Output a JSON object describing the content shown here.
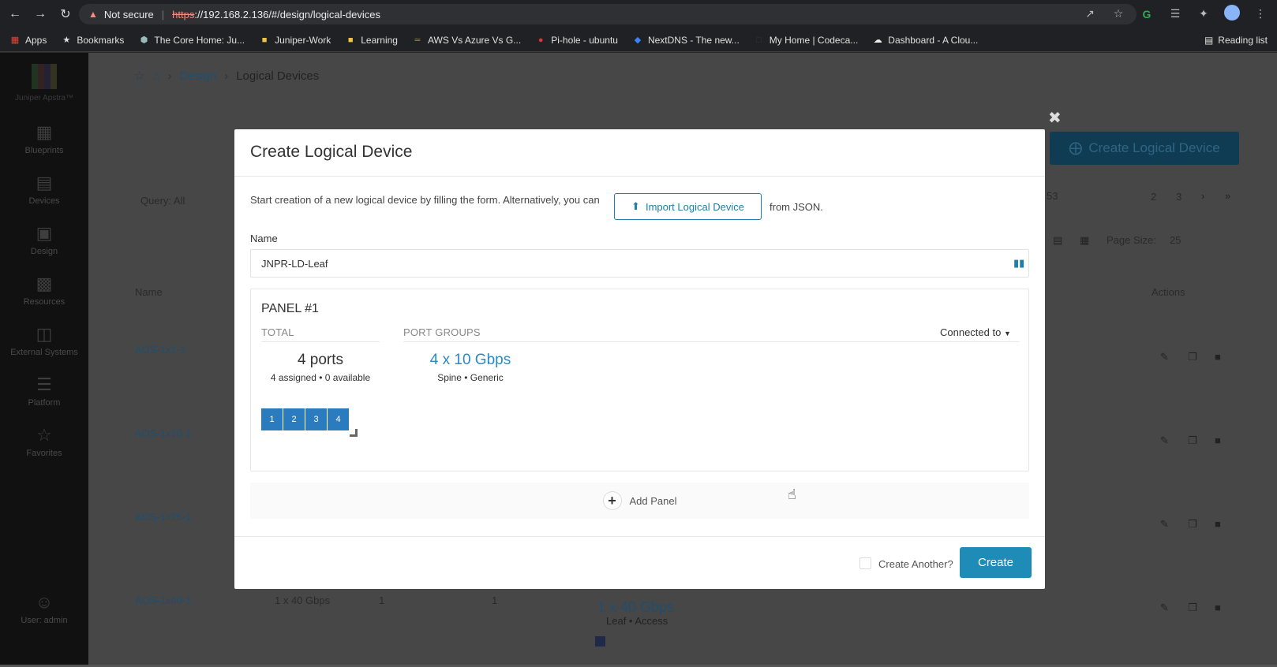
{
  "browser": {
    "not_secure": "Not secure",
    "url_protocol": "https",
    "url_rest": "://192.168.2.136/#/design/logical-devices",
    "bookmarks": [
      {
        "label": "Apps"
      },
      {
        "label": "Bookmarks"
      },
      {
        "label": "The Core Home: Ju..."
      },
      {
        "label": "Juniper-Work"
      },
      {
        "label": "Learning"
      },
      {
        "label": "AWS Vs Azure Vs G..."
      },
      {
        "label": "Pi-hole - ubuntu"
      },
      {
        "label": "NextDNS - The new..."
      },
      {
        "label": "My Home | Codeca..."
      },
      {
        "label": "Dashboard - A Clou..."
      }
    ],
    "reading_list": "Reading list"
  },
  "sidebar": {
    "logo": "Juniper Apstra™",
    "items": [
      {
        "label": "Blueprints"
      },
      {
        "label": "Devices"
      },
      {
        "label": "Design"
      },
      {
        "label": "Resources"
      },
      {
        "label": "External Systems"
      },
      {
        "label": "Platform"
      },
      {
        "label": "Favorites"
      }
    ],
    "user": "User: admin"
  },
  "page": {
    "breadcrumb": [
      "Design",
      "Logical Devices"
    ],
    "create_button": "Create Logical Device",
    "query": "Query: All",
    "pagination": [
      "53",
      "2",
      "3"
    ],
    "page_size_label": "Page Size:",
    "page_size_value": "25",
    "col_name": "Name",
    "col_actions": "Actions",
    "rows": [
      "AOS-1x1-1",
      "AOS-1x10-1",
      "AOS-1x25-1",
      "AOS-1x40-1"
    ],
    "row4_speed": "1 x 40 Gbps",
    "row4_a": "1",
    "row4_b": "1",
    "row4_pg": "1 x 40 Gbps",
    "row4_pg_sub": "Leaf • Access"
  },
  "modal": {
    "title": "Create Logical Device",
    "intro": "Start creation of a new logical device by filling the form. Alternatively, you can",
    "import_label": "Import Logical Device",
    "from_json": "from JSON.",
    "name_label": "Name",
    "name_value": "JNPR-LD-Leaf",
    "panel": {
      "title": "PANEL #1",
      "total_head": "TOTAL",
      "port_groups_head": "PORT GROUPS",
      "connected_to": "Connected to",
      "ports": "4 ports",
      "ports_sub": "4 assigned • 0 available",
      "group": "4 x 10 Gbps",
      "group_sub": "Spine • Generic",
      "port_numbers": [
        "1",
        "2",
        "3",
        "4"
      ]
    },
    "add_panel": "Add Panel",
    "create_another": "Create Another?",
    "create": "Create"
  }
}
